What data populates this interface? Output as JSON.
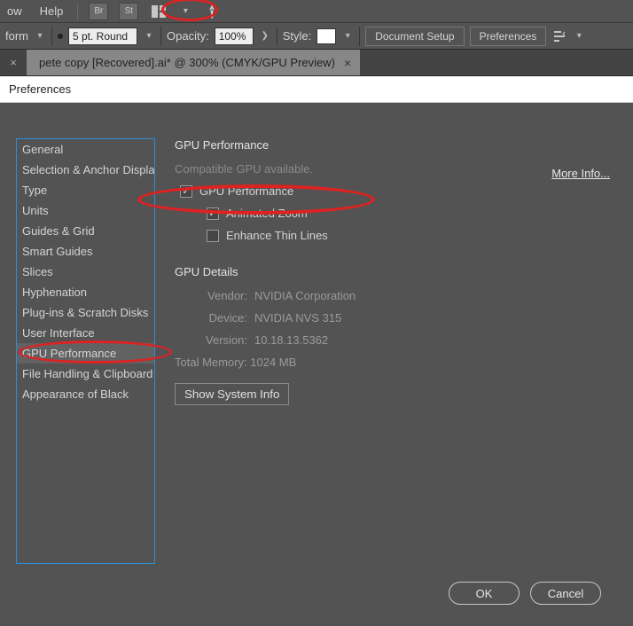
{
  "menubar": {
    "items": [
      "ow",
      "Help"
    ],
    "icon_br": "Br",
    "icon_st": "St"
  },
  "optionsbar": {
    "transform_label": "form",
    "stroke_value": "5 pt. Round",
    "opacity_label": "Opacity:",
    "opacity_value": "100%",
    "style_label": "Style:",
    "doc_setup": "Document Setup",
    "prefs": "Preferences"
  },
  "tab": {
    "title": "pete copy [Recovered].ai* @ 300% (CMYK/GPU Preview)"
  },
  "pref": {
    "window_title": "Preferences",
    "categories": [
      "General",
      "Selection & Anchor Display",
      "Type",
      "Units",
      "Guides & Grid",
      "Smart Guides",
      "Slices",
      "Hyphenation",
      "Plug-ins & Scratch Disks",
      "User Interface",
      "GPU Performance",
      "File Handling & Clipboard",
      "Appearance of Black"
    ],
    "selected_index": 10,
    "panel": {
      "heading": "GPU Performance",
      "status": "Compatible GPU available.",
      "more_info": "More Info...",
      "chk_gpu": "GPU Performance",
      "chk_zoom": "Animated Zoom",
      "chk_thin": "Enhance Thin Lines",
      "gpu_checked": true,
      "zoom_checked": true,
      "thin_checked": false,
      "details_heading": "GPU Details",
      "vendor_label": "Vendor:",
      "vendor_value": "NVIDIA Corporation",
      "device_label": "Device:",
      "device_value": "NVIDIA NVS 315",
      "version_label": "Version:",
      "version_value": "10.18.13.5362",
      "totalmem_label": "Total Memory:",
      "totalmem_value": "1024 MB",
      "sysinfo_btn": "Show System Info"
    },
    "footer": {
      "ok": "OK",
      "cancel": "Cancel"
    }
  }
}
